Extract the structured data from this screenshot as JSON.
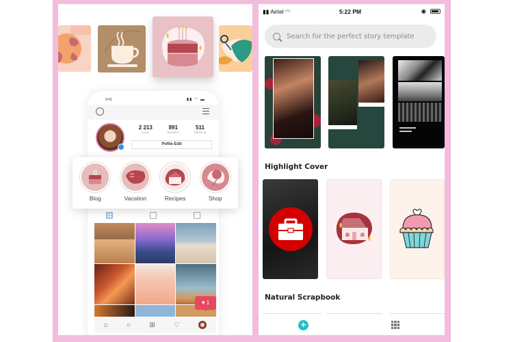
{
  "left_panel": {
    "highlight_tiles": [
      {
        "name": "globe"
      },
      {
        "name": "coffee"
      },
      {
        "name": "birthday-cake"
      },
      {
        "name": "leaf"
      }
    ],
    "phone": {
      "status_time": "9:41",
      "stats": [
        {
          "value": "2 213",
          "label": "posts"
        },
        {
          "value": "891",
          "label": "followers"
        },
        {
          "value": "511",
          "label": "following"
        }
      ],
      "edit_button": "Pofile Edit",
      "highlights": [
        {
          "label": "Blog",
          "icon": "cake-icon"
        },
        {
          "label": "Vacation",
          "icon": "hairdryer-icon"
        },
        {
          "label": "Recipes",
          "icon": "house-icon"
        },
        {
          "label": "Shop",
          "icon": "balloon-icon"
        }
      ],
      "like_count": "1",
      "like_icon": "♥",
      "nav_icons": [
        "home-icon",
        "search-icon",
        "add-icon",
        "heart-icon",
        "profile-icon"
      ]
    }
  },
  "right_panel": {
    "status": {
      "carrier": "Airtel",
      "time": "5:22 PM"
    },
    "search": {
      "placeholder": "Search for the perfect story template"
    },
    "sections": [
      {
        "title": "Highlight Cover"
      },
      {
        "title": "Natural Scrapbook"
      }
    ],
    "bottom_nav": {
      "add_label": "+"
    }
  },
  "colors": {
    "frame_pink": "#f2bcdc",
    "accent_teal": "#1ec1c8",
    "like_red": "#e8485f",
    "briefcase_red": "#d40000"
  }
}
